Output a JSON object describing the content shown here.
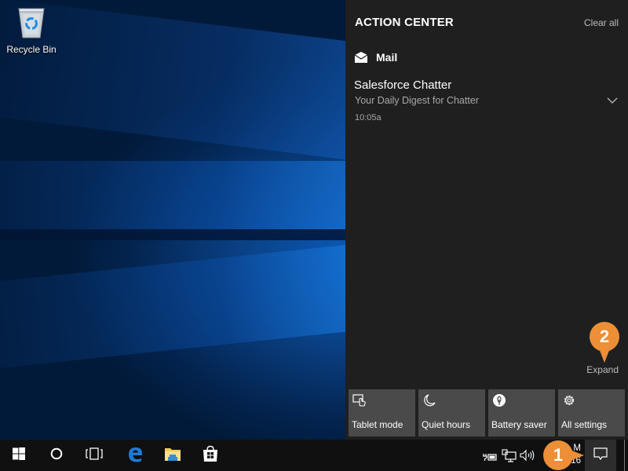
{
  "desktop": {
    "icons": [
      {
        "label": "Recycle Bin",
        "icon": "recycle-bin-icon"
      }
    ]
  },
  "action_center": {
    "title": "ACTION CENTER",
    "clear_all_label": "Clear all",
    "expand_label": "Expand",
    "groups": [
      {
        "app_name": "Mail",
        "app_icon": "mail-icon",
        "notifications": [
          {
            "title": "Salesforce Chatter",
            "body": "Your Daily Digest for Chatter",
            "time": "10:05a"
          }
        ]
      }
    ],
    "quick_actions": [
      {
        "label": "Tablet mode",
        "icon": "tablet-mode-icon"
      },
      {
        "label": "Quiet hours",
        "icon": "moon-icon"
      },
      {
        "label": "Battery saver",
        "icon": "battery-saver-icon"
      },
      {
        "label": "All settings",
        "icon": "gear-icon"
      }
    ]
  },
  "taskbar": {
    "pinned": [
      {
        "name": "start",
        "icon": "windows-logo-icon"
      },
      {
        "name": "cortana",
        "icon": "cortana-circle-icon"
      },
      {
        "name": "task-view",
        "icon": "task-view-icon"
      },
      {
        "name": "edge",
        "icon": "edge-icon"
      },
      {
        "name": "file-explorer",
        "icon": "folder-icon"
      },
      {
        "name": "store",
        "icon": "store-bag-icon"
      }
    ],
    "tray": [
      {
        "name": "power",
        "icon": "battery-plug-icon"
      },
      {
        "name": "network",
        "icon": "network-icon"
      },
      {
        "name": "volume",
        "icon": "speaker-icon"
      }
    ],
    "clock": {
      "time_fragment": "M",
      "date_fragment": "16"
    }
  },
  "callouts": [
    {
      "number": "1",
      "color": "#ec8f37"
    },
    {
      "number": "2",
      "color": "#ec8f37"
    }
  ],
  "colors": {
    "action_center_bg": "#1f1f1f",
    "tile_bg": "#4a4a4a",
    "taskbar_bg": "#101010",
    "edge_blue": "#1e7bd6",
    "accent_orange": "#ec8f37"
  }
}
